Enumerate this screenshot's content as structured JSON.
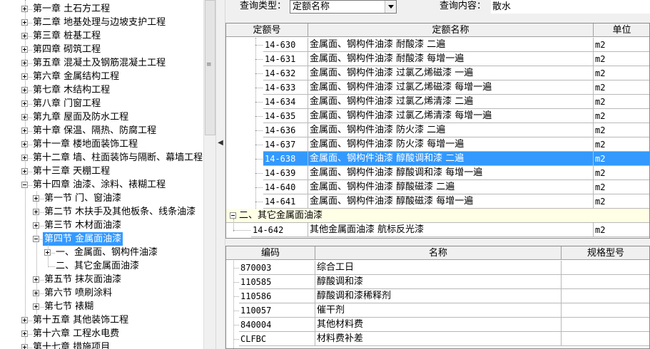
{
  "tree": {
    "chapters_top": [
      "第一章  土石方工程",
      "第二章  地基处理与边坡支护工程",
      "第三章  桩基工程",
      "第四章  砌筑工程",
      "第五章  混凝土及钢筋混凝土工程",
      "第六章  金属结构工程",
      "第七章  木结构工程",
      "第八章  门窗工程",
      "第九章  屋面及防水工程",
      "第十章  保温、隔热、防腐工程",
      "第十一章  楼地面装饰工程",
      "第十二章  墙、柱面装饰与隔断、幕墙工程",
      "第十三章  天棚工程"
    ],
    "chapter_14": "第十四章  油漆、涂料、裱糊工程",
    "sections_before": [
      "第一节  门、窗油漆",
      "第二节  木扶手及其他板条、线条油漆",
      "第三节  木材面油漆"
    ],
    "selected_section": "第四节  金属面油漆",
    "subsections": [
      "一、金属面、钢构件油漆",
      "二、其它金属面油漆"
    ],
    "sections_after": [
      "第五节  抹灰面油漆",
      "第六节  喷刷涂料",
      "第七节  裱糊"
    ],
    "chapters_bottom": [
      "第十五章  其他装饰工程",
      "第十六章  工程水电费",
      "第十七章  措施项目"
    ]
  },
  "query": {
    "type_label": "查询类型：",
    "type_value": "定额名称",
    "content_label": "查询内容：",
    "content_value": "散水"
  },
  "quota_table": {
    "headers": [
      "定额号",
      "定额名称",
      "单位"
    ],
    "rows": [
      {
        "code": "14-630",
        "name": "金属面、钢构件油漆  耐酸漆  二遍",
        "unit": "m2"
      },
      {
        "code": "14-631",
        "name": "金属面、钢构件油漆  耐酸漆  每增一遍",
        "unit": "m2"
      },
      {
        "code": "14-632",
        "name": "金属面、钢构件油漆  过氯乙烯磁漆  一遍",
        "unit": "m2"
      },
      {
        "code": "14-633",
        "name": "金属面、钢构件油漆  过氯乙烯磁漆  每增一遍",
        "unit": "m2"
      },
      {
        "code": "14-634",
        "name": "金属面、钢构件油漆  过氯乙烯清漆  二遍",
        "unit": "m2"
      },
      {
        "code": "14-635",
        "name": "金属面、钢构件油漆  过氯乙烯清漆  每增一遍",
        "unit": "m2"
      },
      {
        "code": "14-636",
        "name": "金属面、钢构件油漆  防火漆  二遍",
        "unit": "m2"
      },
      {
        "code": "14-637",
        "name": "金属面、钢构件油漆  防火漆  每增一遍",
        "unit": "m2"
      },
      {
        "code": "14-638",
        "name": "金属面、钢构件油漆  醇酸调和漆  二遍",
        "unit": "m2"
      },
      {
        "code": "14-639",
        "name": "金属面、钢构件油漆  醇酸调和漆  每增一遍",
        "unit": "m2"
      },
      {
        "code": "14-640",
        "name": "金属面、钢构件油漆  醇酸磁漆  二遍",
        "unit": "m2"
      },
      {
        "code": "14-641",
        "name": "金属面、钢构件油漆  醇酸磁漆  每增一遍",
        "unit": "m2"
      }
    ],
    "selected_code": "14-638",
    "group_label": "二、其它金属面油漆",
    "group_rows": [
      {
        "code": "14-642",
        "name": "其他金属面油漆  航标反光漆",
        "unit": "m2"
      }
    ]
  },
  "material_table": {
    "headers": [
      "编码",
      "名称",
      "规格型号"
    ],
    "rows": [
      {
        "code": "870003",
        "name": "综合工日",
        "spec": ""
      },
      {
        "code": "110585",
        "name": "醇酸调和漆",
        "spec": ""
      },
      {
        "code": "110586",
        "name": "醇酸调和漆稀释剂",
        "spec": ""
      },
      {
        "code": "110057",
        "name": "催干剂",
        "spec": ""
      },
      {
        "code": "840004",
        "name": "其他材料费",
        "spec": ""
      },
      {
        "code": "CLFBC",
        "name": "材料费补差",
        "spec": ""
      }
    ]
  },
  "colors": {
    "selection": "#3399ff",
    "group_row_bg": "#ffffe6",
    "panel_bg": "#f0f0f0"
  }
}
